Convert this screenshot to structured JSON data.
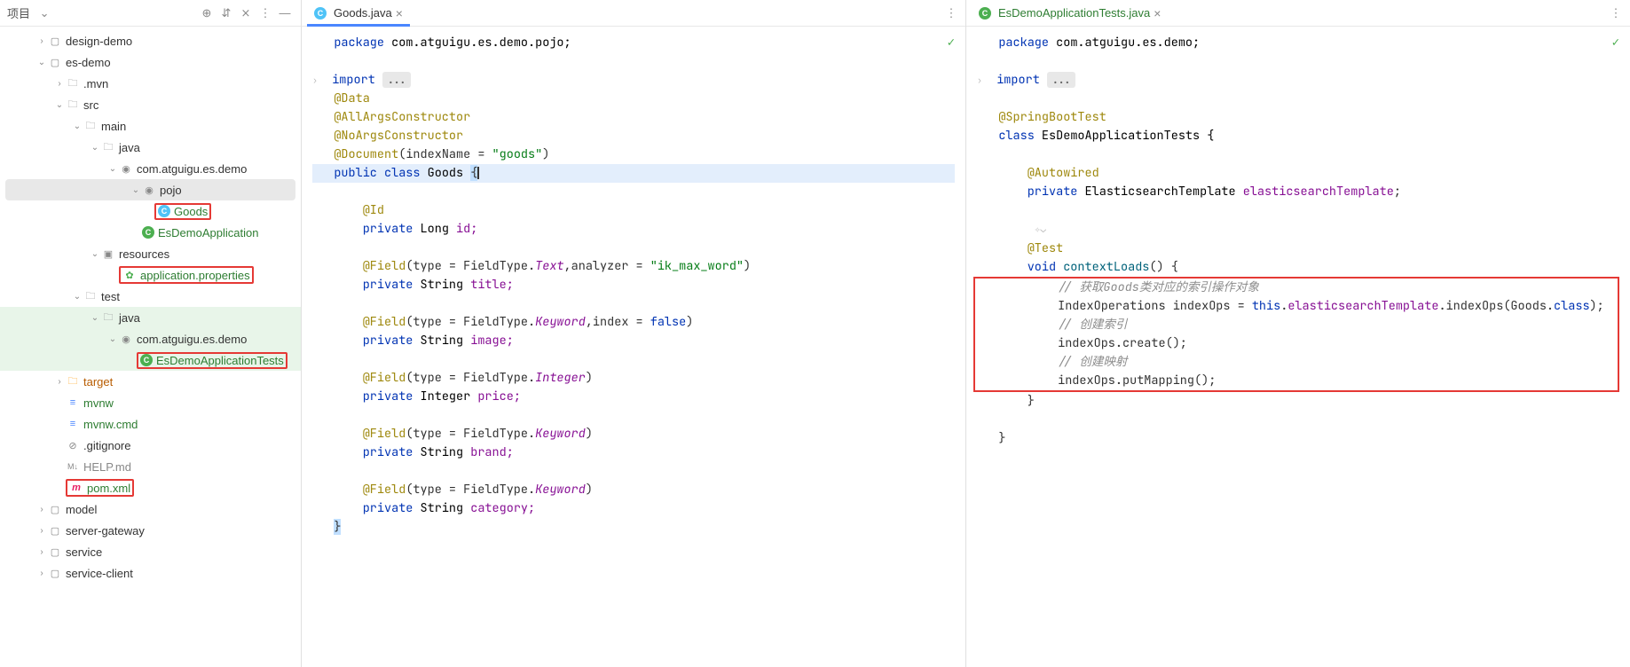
{
  "sidebar": {
    "title": "项目",
    "tree": {
      "design_demo": "design-demo",
      "es_demo": "es-demo",
      "mvn": ".mvn",
      "src": "src",
      "main": "main",
      "java": "java",
      "package_main": "com.atguigu.es.demo",
      "pojo": "pojo",
      "goods": "Goods",
      "es_demo_app": "EsDemoApplication",
      "resources": "resources",
      "app_props": "application.properties",
      "test": "test",
      "java_test": "java",
      "package_test": "com.atguigu.es.demo",
      "tests_class": "EsDemoApplicationTests",
      "target": "target",
      "mvnw": "mvnw",
      "mvnw_cmd": "mvnw.cmd",
      "gitignore": ".gitignore",
      "help_md": "HELP.md",
      "pom_xml": "pom.xml",
      "model": "model",
      "server_gateway": "server-gateway",
      "service": "service",
      "service_client": "service-client"
    }
  },
  "editor_left": {
    "tab_label": "Goods.java",
    "code": {
      "l1_kw": "package",
      "l1_pkg": "com.atguigu.es.demo.pojo;",
      "l3_kw": "import",
      "l3_dots": "...",
      "l4": "@Data",
      "l5": "@AllArgsConstructor",
      "l6": "@NoArgsConstructor",
      "l7a": "@Document",
      "l7b": "(indexName = ",
      "l7c": "\"goods\"",
      "l7d": ")",
      "l8a": "public class ",
      "l8b": "Goods ",
      "l8c": "{",
      "l10": "@Id",
      "l11a": "private ",
      "l11b": "Long ",
      "l11c": "id;",
      "l13a": "@Field",
      "l13b": "(type = FieldType.",
      "l13c": "Text",
      "l13d": ",analyzer = ",
      "l13e": "\"ik_max_word\"",
      "l13f": ")",
      "l14a": "private ",
      "l14b": "String ",
      "l14c": "title;",
      "l16a": "@Field",
      "l16b": "(type = FieldType.",
      "l16c": "Keyword",
      "l16d": ",index = ",
      "l16e": "false",
      "l16f": ")",
      "l17a": "private ",
      "l17b": "String ",
      "l17c": "image;",
      "l19a": "@Field",
      "l19b": "(type = FieldType.",
      "l19c": "Integer",
      "l19d": ")",
      "l20a": "private ",
      "l20b": "Integer ",
      "l20c": "price;",
      "l22a": "@Field",
      "l22b": "(type = FieldType.",
      "l22c": "Keyword",
      "l22d": ")",
      "l23a": "private ",
      "l23b": "String ",
      "l23c": "brand;",
      "l25a": "@Field",
      "l25b": "(type = FieldType.",
      "l25c": "Keyword",
      "l25d": ")",
      "l26a": "private ",
      "l26b": "String ",
      "l26c": "category;",
      "l27": "}"
    }
  },
  "editor_right": {
    "tab_label": "EsDemoApplicationTests.java",
    "code": {
      "l1_kw": "package",
      "l1_pkg": "com.atguigu.es.demo;",
      "l3_kw": "import",
      "l3_dots": "...",
      "l5": "@SpringBootTest",
      "l6a": "class ",
      "l6b": "EsDemoApplicationTests {",
      "l8": "@Autowired",
      "l9a": "private ",
      "l9b": "ElasticsearchTemplate ",
      "l9c": "elasticsearchTemplate",
      "l9d": ";",
      "l11": "@Test",
      "l12a": "void ",
      "l12b": "contextLoads",
      "l12c": "() {",
      "l13": "// 获取Goods类对应的索引操作对象",
      "l14a": "IndexOperations indexOps = ",
      "l14b": "this",
      "l14c": ".",
      "l14d": "elasticsearchTemplate",
      "l14e": ".indexOps(Goods.",
      "l14f": "class",
      "l14g": ");",
      "l15": "// 创建索引",
      "l16": "indexOps.create();",
      "l17": "// 创建映射",
      "l18": "indexOps.putMapping();",
      "l19": "}",
      "l21": "}"
    }
  }
}
